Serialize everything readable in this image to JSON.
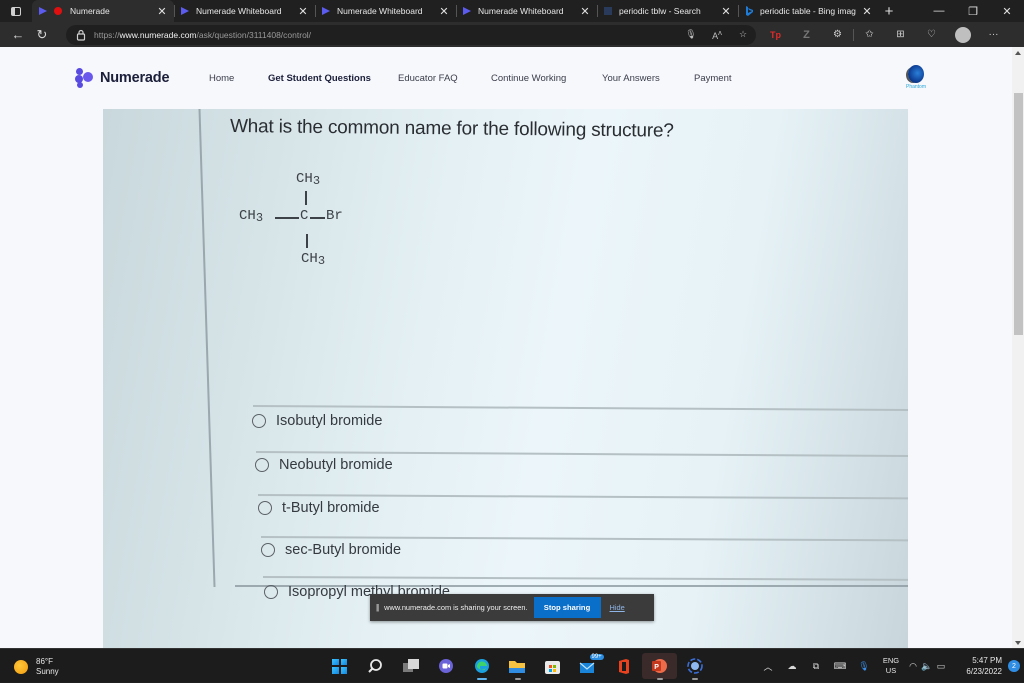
{
  "browser": {
    "tabs": [
      {
        "title": "Numerade",
        "favicon": "numerade-logo-icon",
        "recording": true,
        "active": true
      },
      {
        "title": "Numerade Whiteboard",
        "favicon": "numerade-logo-icon",
        "active": false
      },
      {
        "title": "Numerade Whiteboard",
        "favicon": "numerade-logo-icon",
        "active": false
      },
      {
        "title": "Numerade Whiteboard",
        "favicon": "numerade-logo-icon",
        "active": false
      },
      {
        "title": "periodic tblw - Search",
        "favicon": "search-icon",
        "active": false
      },
      {
        "title": "periodic table - Bing imag",
        "favicon": "bing-icon",
        "active": false
      }
    ],
    "close_glyph": "✕",
    "new_tab_glyph": "+",
    "window_controls": {
      "minimize": "—",
      "restore": "❐",
      "close": "✕"
    },
    "url": {
      "scheme": "https://",
      "host": "www.numerade.com",
      "path": "/ask/question/3111408/control/"
    },
    "nav_glyphs": {
      "back": "←",
      "refresh": "↻"
    },
    "toolbar_icons": [
      "microphone-icon",
      "read-aloud-icon",
      "add-favorite-icon",
      "extension-tp-icon",
      "extension-z-icon",
      "extensions-icon",
      "favorites-icon",
      "collections-icon",
      "browser-essentials-icon",
      "profile-avatar",
      "more-menu-icon"
    ]
  },
  "site": {
    "brand": "Numerade",
    "nav": [
      {
        "label": "Home",
        "emphasis": false
      },
      {
        "label": "Get Student Questions",
        "emphasis": true
      },
      {
        "label": "Educator FAQ",
        "emphasis": false
      },
      {
        "label": "Continue Working",
        "emphasis": false
      },
      {
        "label": "Your Answers",
        "emphasis": false
      },
      {
        "label": "Payment",
        "emphasis": false
      }
    ],
    "phantom_label": "Phantom"
  },
  "question": {
    "text": "What is the common name for the following structure?",
    "structure": {
      "top": "CH3",
      "left": "CH3",
      "center": "C",
      "right": "Br",
      "bottom": "CH3"
    },
    "options": [
      "Isobutyl bromide",
      "Neobutyl bromide",
      "t-Butyl bromide",
      "sec-Butyl bromide",
      "Isopropyl methyl bromide"
    ]
  },
  "share_banner": {
    "pause_glyph": "||",
    "message": "www.numerade.com is sharing your screen.",
    "stop_label": "Stop sharing",
    "hide_label": "Hide",
    "stop_color": "#0a6fc9"
  },
  "taskbar": {
    "weather": {
      "temp": "86°F",
      "condition": "Sunny"
    },
    "apps": [
      "start-icon",
      "search-icon",
      "task-view-icon",
      "teams-chat-icon",
      "edge-icon",
      "file-explorer-icon",
      "microsoft-store-icon",
      "mail-icon",
      "office-icon",
      "powerpoint-icon",
      "screen-recorder-icon"
    ],
    "mail_badge": "99+",
    "language": {
      "line1": "ENG",
      "line2": "US"
    },
    "time": "5:47 PM",
    "date": "6/23/2022",
    "notification_count": "2"
  }
}
